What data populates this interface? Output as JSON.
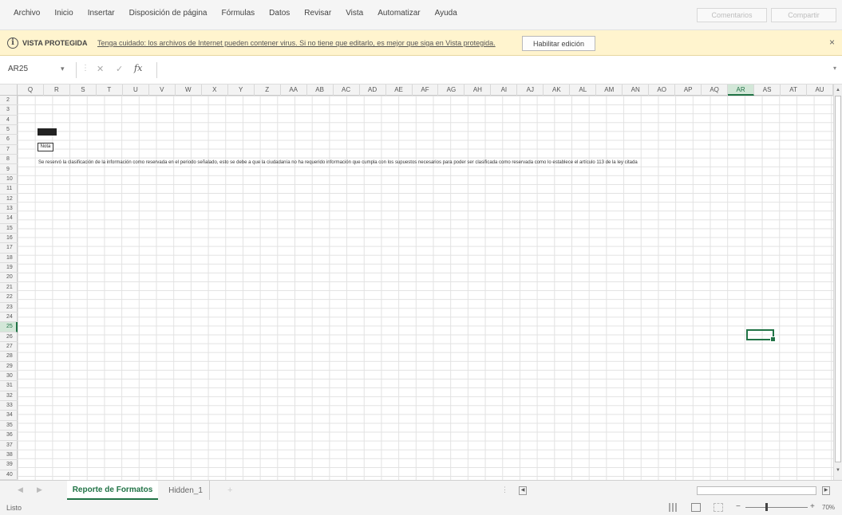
{
  "ribbon": {
    "menu": [
      "Archivo",
      "Inicio",
      "Insertar",
      "Disposición de página",
      "Fórmulas",
      "Datos",
      "Revisar",
      "Vista",
      "Automatizar",
      "Ayuda"
    ],
    "comments_label": "Comentarios",
    "share_label": "Compartir"
  },
  "protected_bar": {
    "label": "VISTA PROTEGIDA",
    "message": "Tenga cuidado: los archivos de Internet pueden contener virus. Si no tiene que editarlo, es mejor que siga en Vista protegida.",
    "enable_label": "Habilitar edición",
    "close": "×"
  },
  "formula_bar": {
    "name_box": "AR25",
    "fx": "fx",
    "value": ""
  },
  "grid": {
    "columns": [
      "Q",
      "R",
      "S",
      "T",
      "U",
      "V",
      "W",
      "X",
      "Y",
      "Z",
      "AA",
      "AB",
      "AC",
      "AD",
      "AE",
      "AF",
      "AG",
      "AH",
      "AI",
      "AJ",
      "AK",
      "AL",
      "AM",
      "AN",
      "AO",
      "AP",
      "AQ",
      "AR",
      "AS",
      "AT",
      "AU"
    ],
    "selected_column": "AR",
    "rows": [
      "2",
      "3",
      "4",
      "5",
      "6",
      "7",
      "8",
      "9",
      "10",
      "11",
      "12",
      "13",
      "14",
      "15",
      "16",
      "17",
      "18",
      "19",
      "20",
      "21",
      "22",
      "23",
      "24",
      "25",
      "26",
      "27",
      "28",
      "29",
      "30",
      "31",
      "32",
      "33",
      "34",
      "35",
      "36",
      "37",
      "38",
      "39",
      "40"
    ],
    "selected_row": "25",
    "nota_label": "Nota",
    "long_text": "Se reservó la clasificación de la información como reservada en el periodo señalado, esto se debe a que la ciudadanía no ha requerido información que cumpla con los supuestos necesarios para poder ser clasificada como reservada como lo establece el artículo 113 de la ley citada"
  },
  "sheets": {
    "active": "Reporte de Formatos",
    "other": "Hidden_1",
    "add": "+"
  },
  "status": {
    "ready": "Listo",
    "zoom": "70%"
  }
}
